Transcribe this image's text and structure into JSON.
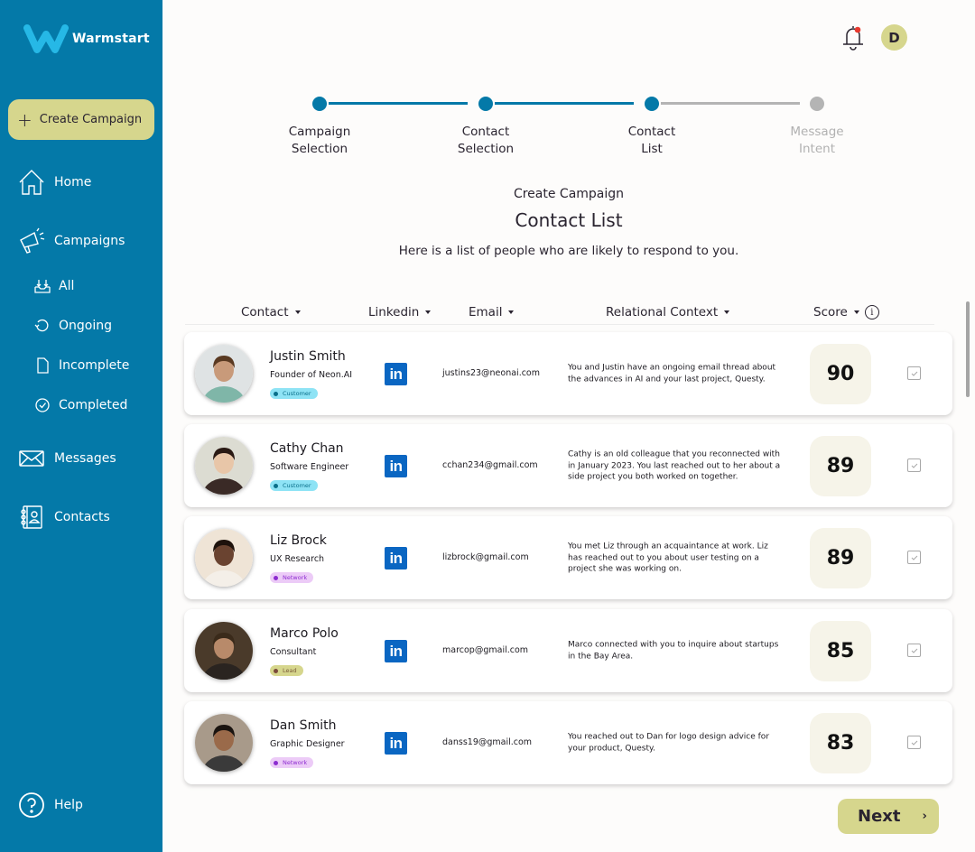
{
  "app": {
    "name": "Warmstart",
    "logo_icon": "warmstart-w-logo"
  },
  "sidebar": {
    "create_button": {
      "label": "Create Campaign",
      "icon": "plus-icon"
    },
    "items": [
      {
        "label": "Home",
        "icon": "home-icon"
      },
      {
        "label": "Campaigns",
        "icon": "megaphone-icon"
      },
      {
        "label": "Messages",
        "icon": "envelope-icon"
      },
      {
        "label": "Contacts",
        "icon": "address-book-icon"
      }
    ],
    "campaign_subitems": [
      {
        "label": "All",
        "icon": "inbox-download-icon"
      },
      {
        "label": "Ongoing",
        "icon": "refresh-icon"
      },
      {
        "label": "Incomplete",
        "icon": "document-icon"
      },
      {
        "label": "Completed",
        "icon": "check-circle-icon"
      }
    ],
    "help": {
      "label": "Help",
      "icon": "question-circle-icon"
    }
  },
  "topbar": {
    "notifications": {
      "icon": "bell-icon",
      "has_unread": true,
      "badge_color": "#e8392e"
    },
    "user_avatar_initial": "D"
  },
  "stepper": {
    "steps": [
      {
        "line1": "Campaign",
        "line2": "Selection",
        "state": "done"
      },
      {
        "line1": "Contact",
        "line2": "Selection",
        "state": "done"
      },
      {
        "line1": "Contact",
        "line2": "List",
        "state": "current"
      },
      {
        "line1": "Message",
        "line2": "Intent",
        "state": "todo"
      }
    ]
  },
  "page": {
    "subtitle": "Create Campaign",
    "title": "Contact List",
    "description": "Here is a list of people who are likely to respond to you."
  },
  "table": {
    "columns": [
      {
        "label": "Contact",
        "sortable": true
      },
      {
        "label": "Linkedin",
        "sortable": true
      },
      {
        "label": "Email",
        "sortable": true
      },
      {
        "label": "Relational Context",
        "sortable": true
      },
      {
        "label": "Score",
        "sortable": true,
        "info_icon": true
      }
    ],
    "rows": [
      {
        "name": "Justin Smith",
        "role": "Founder of Neon.AI",
        "tag": "Customer",
        "tag_type": "customer",
        "linkedin_icon": "linkedin-icon",
        "linkedin_label": "in",
        "email": "justins23@neonai.com",
        "context": "You and Justin have an ongoing email thread about the advances in AI and your last project, Questy.",
        "score": "90",
        "selected": true
      },
      {
        "name": "Cathy Chan",
        "role": "Software Engineer",
        "tag": "Customer",
        "tag_type": "customer",
        "linkedin_icon": "linkedin-icon",
        "linkedin_label": "in",
        "email": "cchan234@gmail.com",
        "context": "Cathy is an old colleague that you reconnected with in January 2023. You last reached out to her about a side project you both worked on together.",
        "score": "89",
        "selected": true
      },
      {
        "name": "Liz Brock",
        "role": "UX Research",
        "tag": "Network",
        "tag_type": "network",
        "linkedin_icon": "linkedin-icon",
        "linkedin_label": "in",
        "email": "lizbrock@gmail.com",
        "context": "You met Liz through an acquaintance at work. Liz has reached out to you about user testing on a project she was working on.",
        "score": "89",
        "selected": true
      },
      {
        "name": "Marco Polo",
        "role": "Consultant",
        "tag": "Lead",
        "tag_type": "lead",
        "linkedin_icon": "linkedin-icon",
        "linkedin_label": "in",
        "email": "marcop@gmail.com",
        "context": "Marco connected with you to inquire about startups in the Bay Area.",
        "score": "85",
        "selected": true
      },
      {
        "name": "Dan Smith",
        "role": "Graphic Designer",
        "tag": "Network",
        "tag_type": "network",
        "linkedin_icon": "linkedin-icon",
        "linkedin_label": "in",
        "email": "danss19@gmail.com",
        "context": "You reached out to Dan for logo design advice for your product, Questy.",
        "score": "83",
        "selected": true
      }
    ]
  },
  "footer": {
    "next_label": "Next",
    "next_icon": "chevron-right-icon",
    "next_glyph": "›"
  },
  "colors": {
    "primary": "#0479a8",
    "accent": "#d6d68d",
    "score_bg": "#f6f4e9",
    "linkedin": "#0a66c2"
  }
}
